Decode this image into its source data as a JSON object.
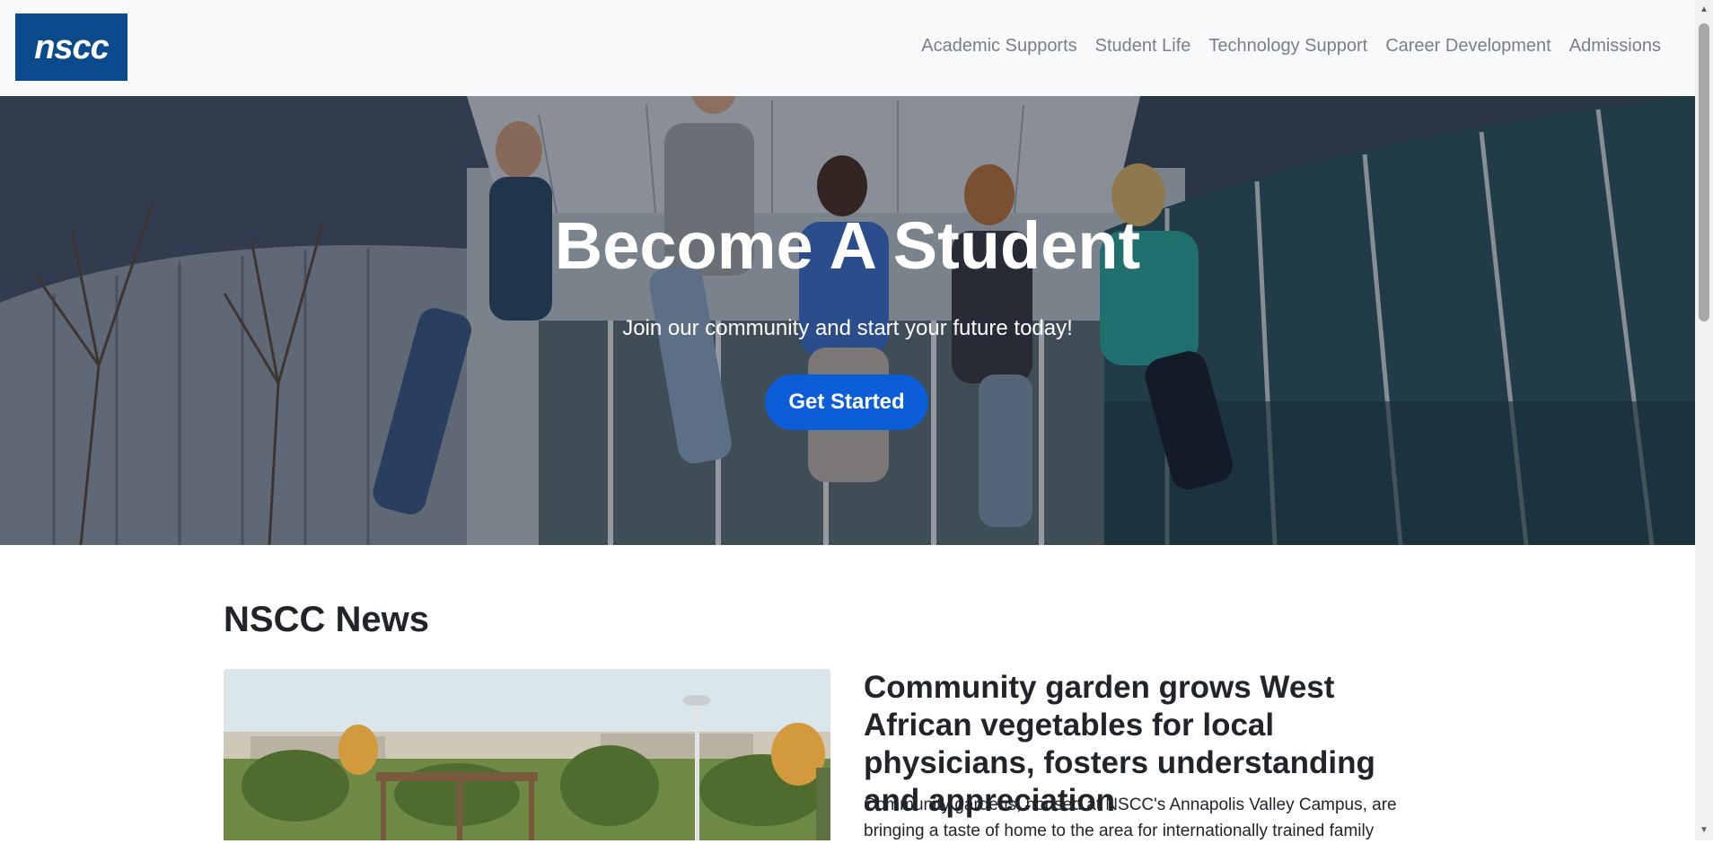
{
  "nav": {
    "logo_text": "nscc",
    "links": [
      {
        "label": "Academic Supports"
      },
      {
        "label": "Student Life"
      },
      {
        "label": "Technology Support"
      },
      {
        "label": "Career Development"
      },
      {
        "label": "Admissions"
      }
    ]
  },
  "hero": {
    "title": "Become A Student",
    "subtitle": "Join our community and start your future today!",
    "button_label": "Get Started"
  },
  "news": {
    "heading": "NSCC News",
    "article": {
      "title": "Community garden grows West African vegetables for local physicians, fosters understanding and appreciation",
      "body": "Community gardens, housed at NSCC's Annapolis Valley Campus, are bringing a taste of home to the area for internationally trained family"
    }
  },
  "colors": {
    "brand_blue": "#0b4a8c",
    "button_blue": "#0b5ed7",
    "nav_text": "#7a7f85"
  },
  "icons": {
    "scroll_up": "chevron-up-icon",
    "scroll_down": "chevron-down-icon"
  }
}
